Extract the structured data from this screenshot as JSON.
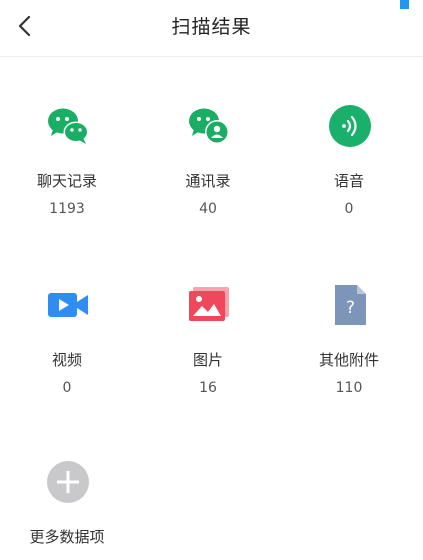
{
  "header": {
    "title": "扫描结果",
    "back_icon": "chevron-left-icon",
    "accent_color": "#2196f3"
  },
  "items": [
    {
      "label": "聊天记录",
      "count": "1193",
      "icon": "wechat-chat-icon",
      "color": "#1aad64"
    },
    {
      "label": "通讯录",
      "count": "40",
      "icon": "wechat-contacts-icon",
      "color": "#1aad64"
    },
    {
      "label": "语音",
      "count": "0",
      "icon": "voice-icon",
      "color": "#1ab06b"
    },
    {
      "label": "视频",
      "count": "0",
      "icon": "video-camera-icon",
      "color": "#2f8cf0"
    },
    {
      "label": "图片",
      "count": "16",
      "icon": "image-icon",
      "color": "#f0485a"
    },
    {
      "label": "其他附件",
      "count": "110",
      "icon": "unknown-file-icon",
      "color": "#7d95b8"
    }
  ],
  "more": {
    "label": "更多数据项",
    "icon": "plus-circle-icon",
    "color": "#c9c9cc"
  }
}
